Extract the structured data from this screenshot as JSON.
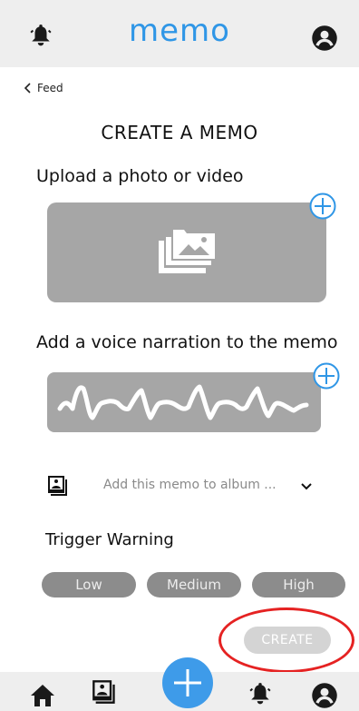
{
  "header": {
    "title": "memo",
    "bell_icon": "bell-icon",
    "profile_icon": "user-circle-icon"
  },
  "nav": {
    "back_label": "Feed"
  },
  "page": {
    "heading": "CREATE A MEMO"
  },
  "upload": {
    "label": "Upload a photo or video",
    "icon": "photo-album-icon",
    "add_icon": "plus-circle-icon"
  },
  "voice": {
    "label": "Add a voice narration to the memo",
    "icon": "waveform-icon",
    "add_icon": "plus-circle-icon"
  },
  "album": {
    "placeholder": "Add this memo to album ...",
    "icon": "album-stack-icon",
    "dropdown_icon": "chevron-down-icon"
  },
  "trigger": {
    "label": "Trigger Warning",
    "options": [
      "Low",
      "Medium",
      "High"
    ]
  },
  "actions": {
    "create_label": "CREATE"
  },
  "bottom_nav": {
    "items": [
      "home-icon",
      "album-stack-icon",
      "plus-icon",
      "bell-icon",
      "user-circle-icon"
    ]
  },
  "colors": {
    "accent": "#2f96e6",
    "bar_bg": "#eeeeee",
    "box_grey": "#a6a6a6",
    "pill_grey": "#8c8c8c",
    "annotation": "#e52222"
  }
}
